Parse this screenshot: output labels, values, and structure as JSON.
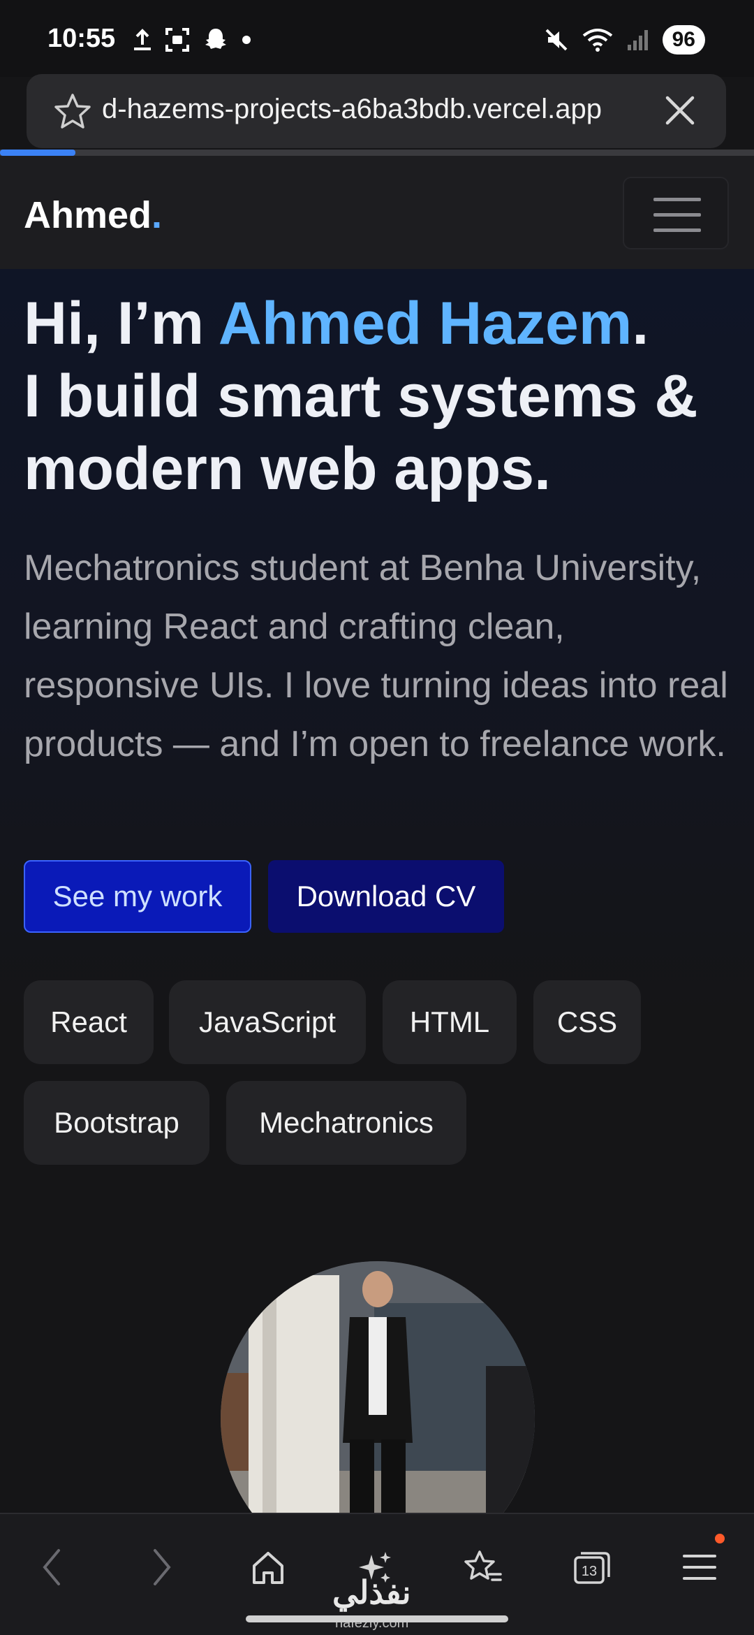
{
  "status_bar": {
    "time": "10:55",
    "battery": "96",
    "icons_left": [
      "upload-icon",
      "screenshot-icon",
      "snapchat-icon",
      "dot-icon"
    ],
    "icons_right": [
      "mute-icon",
      "wifi-icon",
      "signal-icon"
    ]
  },
  "browser": {
    "url": "d-hazems-projects-a6ba3bdb.vercel.app",
    "load_progress": 0.1
  },
  "navbar": {
    "brand": "Ahmed",
    "brand_dot": "."
  },
  "hero": {
    "headline_pre": "Hi, I’m ",
    "headline_name": "Ahmed Hazem",
    "headline_dot": ".",
    "headline_line2": "I build smart systems &",
    "headline_line3": "modern web apps.",
    "subtitle": "Mechatronics student at Benha University, learning React and crafting clean, responsive UIs. I love turning ideas into real products — and I’m open to freelance work.",
    "primary_button": "See my work",
    "secondary_button": "Download CV",
    "skills": [
      "React",
      "JavaScript",
      "HTML",
      "CSS",
      "Bootstrap",
      "Mechatronics"
    ]
  },
  "bottom_bar": {
    "tabs_count": "13",
    "watermark": "نفذلي",
    "watermark_sub": "nafezly.com"
  },
  "colors": {
    "accent": "#5fb4ff",
    "primary_button_bg": "#0a1ab8",
    "secondary_button_bg": "#0b0e6f",
    "progress": "#3b82f6"
  }
}
